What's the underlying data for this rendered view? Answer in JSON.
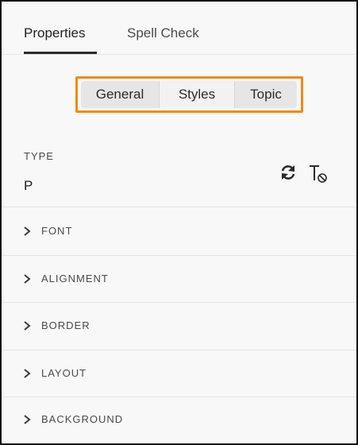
{
  "tabs": {
    "properties": "Properties",
    "spell_check": "Spell Check"
  },
  "segments": {
    "general": "General",
    "styles": "Styles",
    "topic": "Topic",
    "highlight_color": "#f08a15"
  },
  "type_section": {
    "label": "TYPE",
    "value": "P",
    "icons": [
      "refresh-icon",
      "clear-formatting-icon"
    ]
  },
  "accordion": {
    "font": "FONT",
    "alignment": "ALIGNMENT",
    "border": "BORDER",
    "layout": "LAYOUT",
    "background": "BACKGROUND"
  }
}
